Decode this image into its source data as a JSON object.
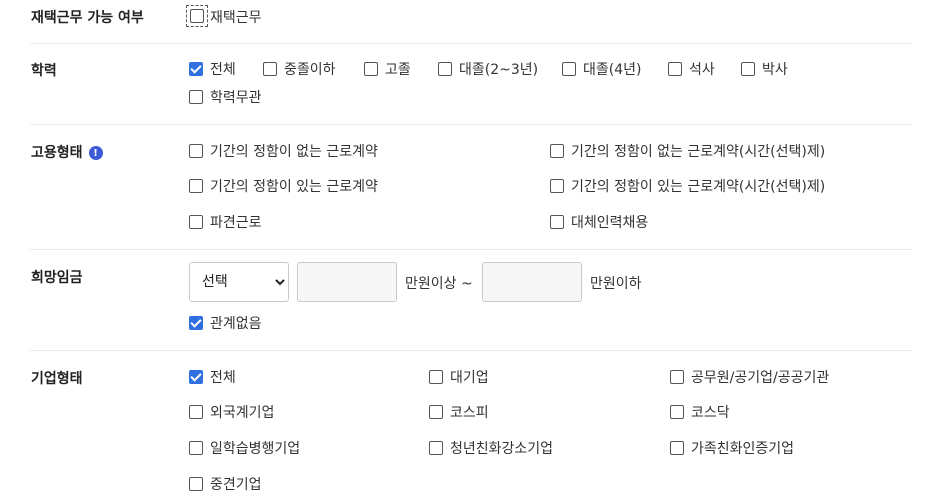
{
  "remote": {
    "label": "재택근무 가능 여부",
    "option": {
      "label": "재택근무",
      "checked": false
    }
  },
  "education": {
    "label": "학력",
    "options": [
      {
        "label": "전체",
        "checked": true
      },
      {
        "label": "중졸이하",
        "checked": false
      },
      {
        "label": "고졸",
        "checked": false
      },
      {
        "label": "대졸(2~3년)",
        "checked": false
      },
      {
        "label": "대졸(4년)",
        "checked": false
      },
      {
        "label": "석사",
        "checked": false
      },
      {
        "label": "박사",
        "checked": false
      },
      {
        "label": "학력무관",
        "checked": false
      }
    ]
  },
  "employment": {
    "label": "고용형태",
    "info_icon": "info-icon",
    "options": [
      {
        "label": "기간의 정함이 없는 근로계약",
        "checked": false
      },
      {
        "label": "기간의 정함이 없는 근로계약(시간(선택)제)",
        "checked": false
      },
      {
        "label": "기간의 정함이 있는 근로계약",
        "checked": false
      },
      {
        "label": "기간의 정함이 있는 근로계약(시간(선택)제)",
        "checked": false
      },
      {
        "label": "파견근로",
        "checked": false
      },
      {
        "label": "대체인력채용",
        "checked": false
      }
    ]
  },
  "salary": {
    "label": "희망임금",
    "select_value": "선택",
    "min_value": "",
    "min_suffix": "만원이상 ~",
    "max_value": "",
    "max_suffix": "만원이하",
    "no_matter": {
      "label": "관계없음",
      "checked": true
    }
  },
  "company": {
    "label": "기업형태",
    "options": [
      {
        "label": "전체",
        "checked": true
      },
      {
        "label": "대기업",
        "checked": false
      },
      {
        "label": "공무원/공기업/공공기관",
        "checked": false
      },
      {
        "label": "외국계기업",
        "checked": false
      },
      {
        "label": "코스피",
        "checked": false
      },
      {
        "label": "코스닥",
        "checked": false
      },
      {
        "label": "일학습병행기업",
        "checked": false
      },
      {
        "label": "청년친화강소기업",
        "checked": false
      },
      {
        "label": "가족친화인증기업",
        "checked": false
      },
      {
        "label": "중견기업",
        "checked": false
      }
    ]
  },
  "colors": {
    "accent": "#2f6fe0",
    "info": "#3d5bd6"
  }
}
